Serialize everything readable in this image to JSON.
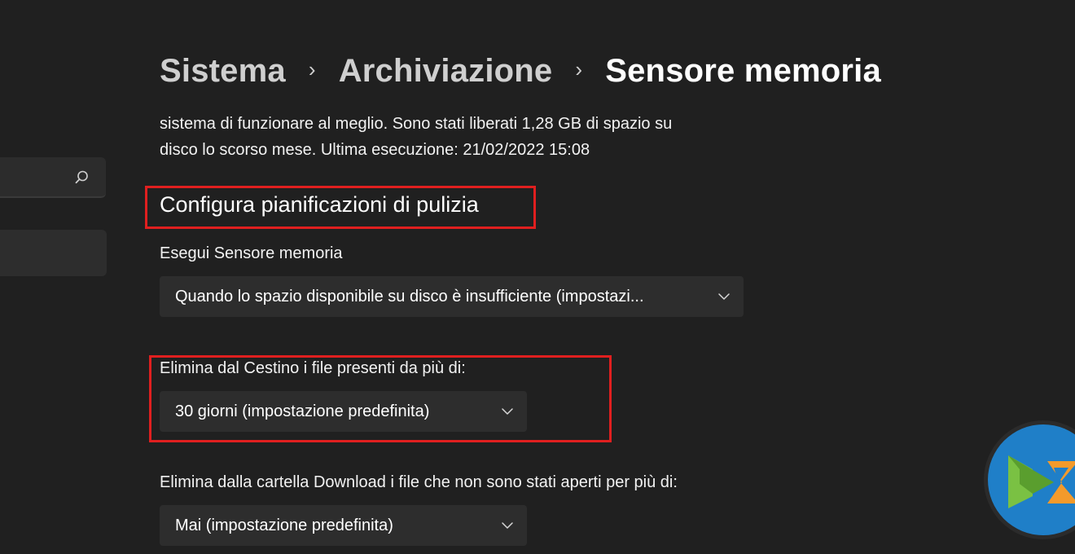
{
  "breadcrumb": {
    "items": [
      "Sistema",
      "Archiviazione",
      "Sensore memoria"
    ],
    "separator": "›"
  },
  "description": {
    "line1": "sistema di funzionare al meglio. Sono stati liberati 1,28 GB di spazio su",
    "line2": "disco lo scorso mese. Ultima esecuzione: 21/02/2022 15:08"
  },
  "section": {
    "title": "Configura pianificazioni di pulizia"
  },
  "settings": {
    "run_sensor": {
      "label": "Esegui Sensore memoria",
      "value": "Quando lo spazio disponibile su disco è insufficiente (impostazi..."
    },
    "recycle_bin": {
      "label": "Elimina dal Cestino i file presenti da più di:",
      "value": "30 giorni (impostazione predefinita)"
    },
    "downloads": {
      "label": "Elimina dalla cartella Download i file che non sono stati aperti per più di:",
      "value": "Mai (impostazione predefinita)"
    }
  },
  "icons": {
    "search": "search-icon",
    "chevron": "chevron-down-icon",
    "logo": "brand-logo-icon"
  },
  "colors": {
    "background": "#202020",
    "control": "#2d2d2d",
    "highlight": "#e01f1f",
    "logo_blue": "#1f7fc8",
    "logo_green": "#7ac143",
    "logo_orange": "#f39a2b"
  }
}
